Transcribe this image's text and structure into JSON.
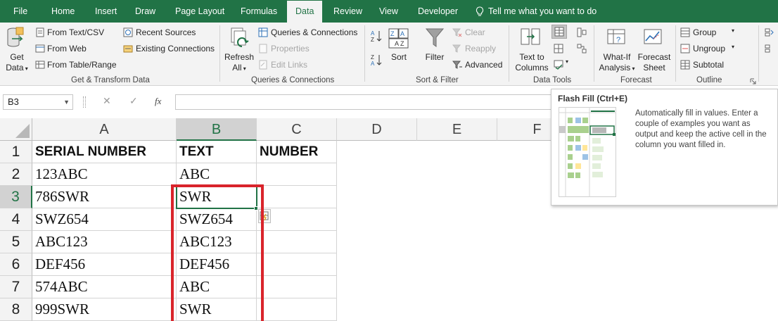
{
  "tabs": {
    "file": "File",
    "home": "Home",
    "insert": "Insert",
    "draw": "Draw",
    "page_layout": "Page Layout",
    "formulas": "Formulas",
    "data": "Data",
    "review": "Review",
    "view": "View",
    "developer": "Developer",
    "tell_me": "Tell me what you want to do"
  },
  "ribbon": {
    "get_transform": {
      "get_data_1": "Get",
      "get_data_2": "Data",
      "from_text_csv": "From Text/CSV",
      "from_web": "From Web",
      "from_table_range": "From Table/Range",
      "recent_sources": "Recent Sources",
      "existing_connections": "Existing Connections",
      "label": "Get & Transform Data"
    },
    "queries": {
      "refresh_1": "Refresh",
      "refresh_2": "All",
      "queries_connections": "Queries & Connections",
      "properties": "Properties",
      "edit_links": "Edit Links",
      "label": "Queries & Connections"
    },
    "sort_filter": {
      "sort": "Sort",
      "filter": "Filter",
      "clear": "Clear",
      "reapply": "Reapply",
      "advanced": "Advanced",
      "label": "Sort & Filter"
    },
    "data_tools": {
      "text_to_1": "Text to",
      "text_to_2": "Columns",
      "label": "Data Tools"
    },
    "forecast": {
      "what_if_1": "What-If",
      "what_if_2": "Analysis",
      "forecast_1": "Forecast",
      "forecast_2": "Sheet",
      "label": "Forecast"
    },
    "outline": {
      "group": "Group",
      "ungroup": "Ungroup",
      "subtotal": "Subtotal",
      "label": "Outline"
    }
  },
  "formula_bar": {
    "name_box": "B3",
    "fx": "fx",
    "value": ""
  },
  "grid": {
    "columns": [
      "A",
      "B",
      "C",
      "D",
      "E",
      "F"
    ],
    "rows": [
      {
        "num": "1",
        "a": "SERIAL NUMBER",
        "b": "TEXT",
        "c": "NUMBER"
      },
      {
        "num": "2",
        "a": "123ABC",
        "b": "ABC",
        "c": ""
      },
      {
        "num": "3",
        "a": "786SWR",
        "b": "SWR",
        "c": ""
      },
      {
        "num": "4",
        "a": "SWZ654",
        "b": "SWZ654",
        "c": ""
      },
      {
        "num": "5",
        "a": "ABC123",
        "b": "ABC123",
        "c": ""
      },
      {
        "num": "6",
        "a": "DEF456",
        "b": "DEF456",
        "c": ""
      },
      {
        "num": "7",
        "a": "574ABC",
        "b": "ABC",
        "c": ""
      },
      {
        "num": "8",
        "a": "999SWR",
        "b": "SWR",
        "c": ""
      }
    ]
  },
  "tooltip": {
    "title": "Flash Fill (Ctrl+E)",
    "description": "Automatically fill in values. Enter a couple of examples you want as output and keep the active cell in the column you want filled in."
  },
  "colors": {
    "excel_green": "#217346",
    "highlight_red": "#d9242b",
    "ribbon_bg": "#f3f3f3"
  }
}
